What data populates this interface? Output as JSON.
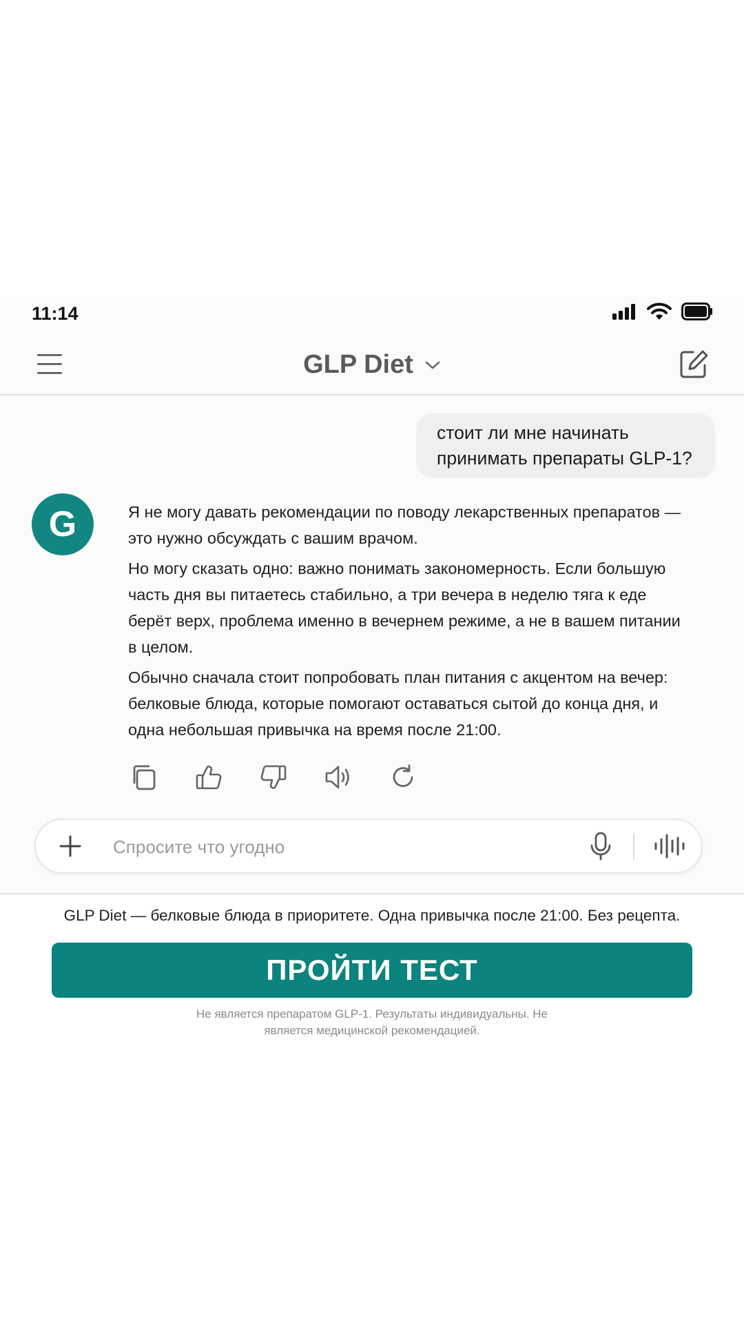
{
  "status_bar": {
    "time": "11:14"
  },
  "header": {
    "title": "GLP Diet"
  },
  "chat": {
    "user_message": "стоит ли мне начинать принимать препараты GLP-1?",
    "avatar_letter": "G",
    "assistant_paragraphs": [
      "Я не могу давать рекомендации по поводу лекарственных препаратов — это нужно обсуждать с вашим врачом.",
      "Но могу сказать одно: важно понимать закономерность. Если большую часть дня вы питаетесь стабильно, а три вечера в неделю тяга к еде берёт верх, проблема именно в вечернем режиме, а не в вашем питании в целом.",
      "Обычно сначала стоит попробовать план питания с акцентом на вечер: белковые блюда, которые помогают оставаться сытой до конца дня, и одна небольшая привычка на время после 21:00."
    ],
    "actions": [
      "copy-icon",
      "thumbs-up-icon",
      "thumbs-down-icon",
      "speaker-icon",
      "regenerate-icon"
    ]
  },
  "composer": {
    "placeholder": "Спросите что угодно"
  },
  "promo": {
    "tagline": "GLP Diet — белковые блюда в приоритете. Одна привычка после 21:00. Без рецепта.",
    "cta_label": "ПРОЙТИ ТЕСТ",
    "disclaimer": "Не является препаратом GLP-1. Результаты индивидуальны. Не является медицинской рекомендацией."
  },
  "colors": {
    "accent": "#0b837e",
    "avatar": "#128781",
    "bubble": "#efefef"
  }
}
